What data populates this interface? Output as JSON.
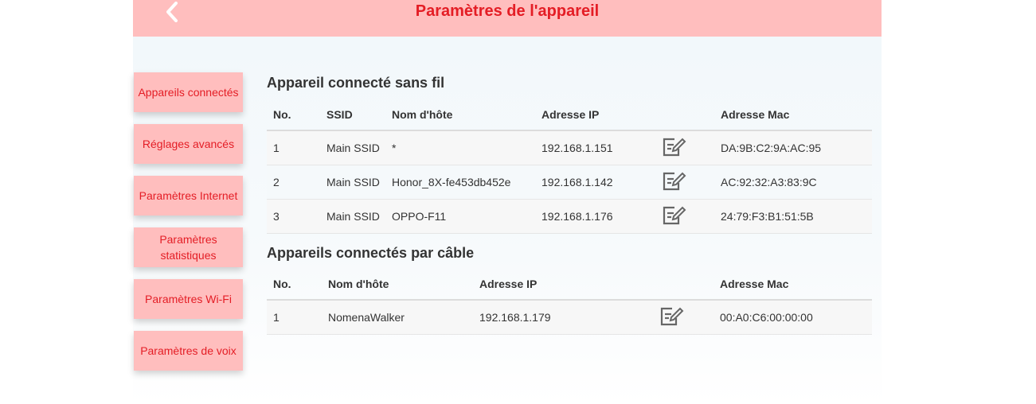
{
  "header": {
    "title": "Paramètres de l'appareil"
  },
  "sidebar": {
    "items": [
      {
        "label": "Appareils connectés"
      },
      {
        "label": "Réglages avancés"
      },
      {
        "label": "Paramètres Internet"
      },
      {
        "label": "Paramètres statistiques"
      },
      {
        "label": "Paramètres Wi-Fi"
      },
      {
        "label": "Paramètres de voix"
      }
    ]
  },
  "wireless": {
    "title": "Appareil connecté sans fil",
    "headers": {
      "no": "No.",
      "ssid": "SSID",
      "host": "Nom d'hôte",
      "ip": "Adresse IP",
      "mac": "Adresse Mac"
    },
    "rows": [
      {
        "no": "1",
        "ssid": "Main SSID",
        "host": "*",
        "ip": "192.168.1.151",
        "mac": "DA:9B:C2:9A:AC:95"
      },
      {
        "no": "2",
        "ssid": "Main SSID",
        "host": "Honor_8X-fe453db452e",
        "ip": "192.168.1.142",
        "mac": "AC:92:32:A3:83:9C"
      },
      {
        "no": "3",
        "ssid": "Main SSID",
        "host": "OPPO-F11",
        "ip": "192.168.1.176",
        "mac": "24:79:F3:B1:51:5B"
      }
    ]
  },
  "wired": {
    "title": "Appareils connectés par câble",
    "headers": {
      "no": "No.",
      "host": "Nom d'hôte",
      "ip": "Adresse IP",
      "mac": "Adresse Mac"
    },
    "rows": [
      {
        "no": "1",
        "host": "NomenaWalker",
        "ip": "192.168.1.179",
        "mac": "00:A0:C6:00:00:00"
      }
    ]
  },
  "colors": {
    "accent": "#e41d25",
    "pink": "#ffbebe"
  }
}
